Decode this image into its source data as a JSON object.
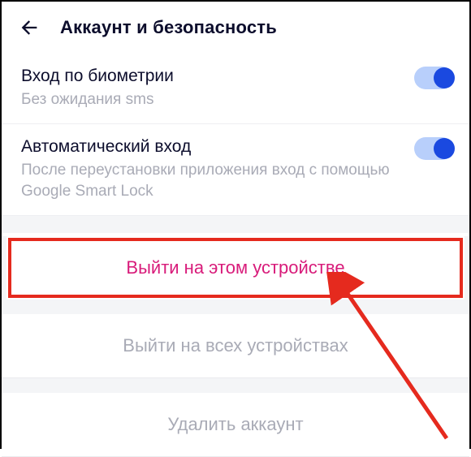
{
  "header": {
    "title": "Аккаунт и безопасность"
  },
  "settings": [
    {
      "title": "Вход по биометрии",
      "subtitle": "Без ожидания sms",
      "toggle": true
    },
    {
      "title": "Автоматический вход",
      "subtitle": "После переустановки приложения вход с помощью Google Smart Lock",
      "toggle": true
    }
  ],
  "actions": {
    "logout_this_device": "Выйти на этом устройстве",
    "logout_all_devices": "Выйти на всех устройствах",
    "delete_account": "Удалить аккаунт"
  }
}
